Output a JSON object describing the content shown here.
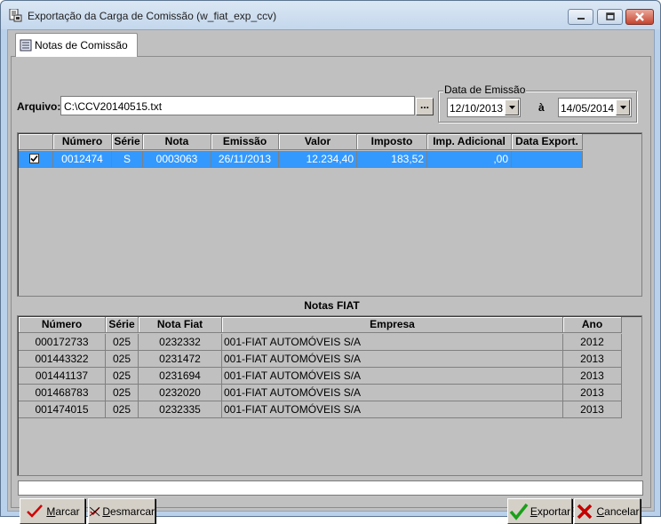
{
  "window": {
    "title": "Exportação da Carga de Comissão (w_fiat_exp_ccv)"
  },
  "tab": {
    "label": "Notas de Comissão"
  },
  "arquivo": {
    "label": "Arquivo:",
    "value": "C:\\CCV20140515.txt",
    "browse_label": "..."
  },
  "data_emissao": {
    "title": "Data de Emissão",
    "from": "12/10/2013",
    "separator": "à",
    "to": "14/05/2014"
  },
  "notas_comissao": {
    "columns": [
      "Número",
      "Série",
      "Nota",
      "Emissão",
      "Valor",
      "Imposto",
      "Imp. Adicional",
      "Data Export."
    ],
    "rows": [
      {
        "checked": true,
        "numero": "0012474",
        "serie": "S",
        "nota": "0003063",
        "emissao": "26/11/2013",
        "valor": "12.234,40",
        "imposto": "183,52",
        "imp_adicional": ",00",
        "data_export": ""
      }
    ]
  },
  "notas_fiat": {
    "title": "Notas FIAT",
    "columns": [
      "Número",
      "Série",
      "Nota Fiat",
      "Empresa",
      "Ano"
    ],
    "rows": [
      {
        "numero": "000172733",
        "serie": "025",
        "nota_fiat": "0232332",
        "empresa": "001-FIAT AUTOMÓVEIS S/A",
        "ano": "2012"
      },
      {
        "numero": "001443322",
        "serie": "025",
        "nota_fiat": "0231472",
        "empresa": "001-FIAT AUTOMÓVEIS S/A",
        "ano": "2013"
      },
      {
        "numero": "001441137",
        "serie": "025",
        "nota_fiat": "0231694",
        "empresa": "001-FIAT AUTOMÓVEIS S/A",
        "ano": "2013"
      },
      {
        "numero": "001468783",
        "serie": "025",
        "nota_fiat": "0232020",
        "empresa": "001-FIAT AUTOMÓVEIS S/A",
        "ano": "2013"
      },
      {
        "numero": "001474015",
        "serie": "025",
        "nota_fiat": "0232335",
        "empresa": "001-FIAT AUTOMÓVEIS S/A",
        "ano": "2013"
      }
    ]
  },
  "buttons": {
    "marcar": {
      "hotkey": "M",
      "rest": "arcar",
      "icon": "checkmark-icon"
    },
    "desmarcar": {
      "hotkey": "D",
      "rest": "esmarcar",
      "icon": "uncheck-icon"
    },
    "exportar": {
      "hotkey": "E",
      "rest": "xportar",
      "icon": "green-check-icon"
    },
    "cancelar": {
      "hotkey": "C",
      "rest": "ancelar",
      "icon": "red-x-icon"
    }
  },
  "colors": {
    "selection": "#3399ff",
    "form_bg": "#c0c0c0",
    "frame": "#b9d1ea"
  }
}
